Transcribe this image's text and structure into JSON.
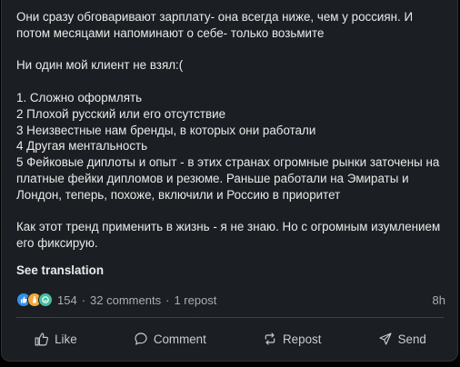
{
  "post": {
    "lines": [
      "Они сразу обговаривают зарплату- она всегда ниже, чем у россиян. И",
      "потом месяцами напоминают о себе- только возьмите",
      "",
      "Ни один мой клиент не взял:(",
      "",
      "1. Сложно оформлять",
      "2 Плохой русский или его отсутствие",
      "3 Неизвестные нам бренды, в которых они работали",
      "4 Другая ментальность",
      "5 Фейковые диплоты и опыт - в этих странах огромные рынки заточены на",
      "платные фейки дипломов и резюме. Раньше работали на Эмираты и",
      "Лондон, теперь, похоже, включили и Россию в приоритет",
      "",
      "Как этот тренд применить в жизнь - я не знаю. Но с огромным изумлением",
      "его фиксирую."
    ],
    "see_translation": "See translation"
  },
  "social": {
    "reaction_count": "154",
    "separator": "·",
    "comments": "32 comments",
    "reposts": "1 repost",
    "time": "8h",
    "reaction_icons": [
      "like-icon",
      "celebrate-icon",
      "support-icon"
    ]
  },
  "actions": {
    "like": "Like",
    "comment": "Comment",
    "repost": "Repost",
    "send": "Send"
  },
  "colors": {
    "card_bg": "#1b1f23",
    "page_bg": "#000000",
    "text": "#e9e9e9",
    "muted": "#a9aeb3",
    "like_blue": "#378fe9",
    "celebrate_orange": "#f3a93b",
    "support_teal": "#44bfa3"
  }
}
